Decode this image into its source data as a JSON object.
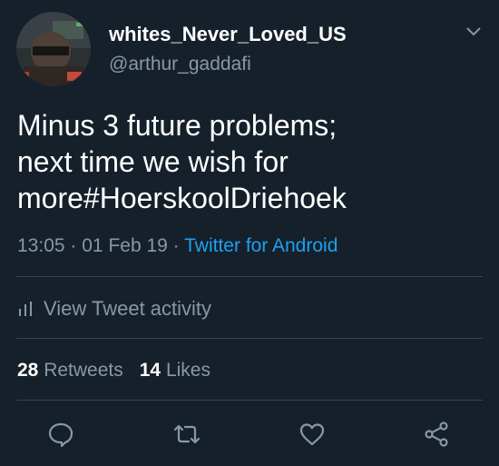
{
  "user": {
    "display_name": "whites_Never_Loved_US",
    "handle": "@arthur_gaddafi"
  },
  "tweet": {
    "lines": [
      "Minus 3 future problems;",
      "next time we wish for",
      "more#HoerskoolDriehoek"
    ],
    "time": "13:05",
    "date": "01 Feb 19",
    "separator": "·",
    "source": "Twitter for Android"
  },
  "activity": {
    "label": "View Tweet activity",
    "icon": "bar-chart-icon"
  },
  "stats": {
    "retweets_count": "28",
    "retweets_label": "Retweets",
    "likes_count": "14",
    "likes_label": "Likes"
  },
  "actions": [
    "reply-icon",
    "retweet-icon",
    "like-icon",
    "share-icon"
  ],
  "colors": {
    "background": "#15202b",
    "text": "#ffffff",
    "secondary": "#8899a6",
    "accent": "#1da1f2",
    "divider": "#38444d"
  }
}
